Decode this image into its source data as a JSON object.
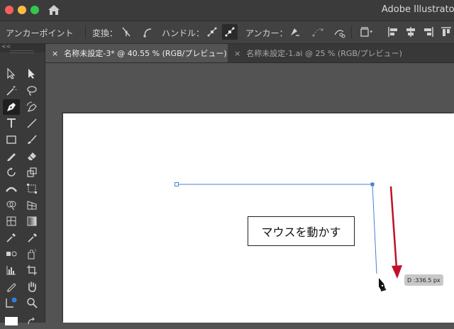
{
  "app_title": "Adobe Illustrator",
  "control_bar": {
    "tool_name": "アンカーポイント",
    "convert_label": "変換：",
    "handle_label": "ハンドル：",
    "anchor_label": "アンカー："
  },
  "tool_panel": {
    "header": "<<"
  },
  "tabs": [
    {
      "close": "×",
      "label": "名称未設定-3* @ 40.55 % (RGB/プレビュー)",
      "active": true
    },
    {
      "close": "×",
      "label": "名称未設定-1.ai @ 25 % (RGB/プレビュー)",
      "active": false
    }
  ],
  "canvas": {
    "callout_text": "マウスを動かす",
    "distance_tooltip": "D :336.5 px",
    "path_color": "#4a7fd8",
    "arrow_color": "#c0102a"
  }
}
